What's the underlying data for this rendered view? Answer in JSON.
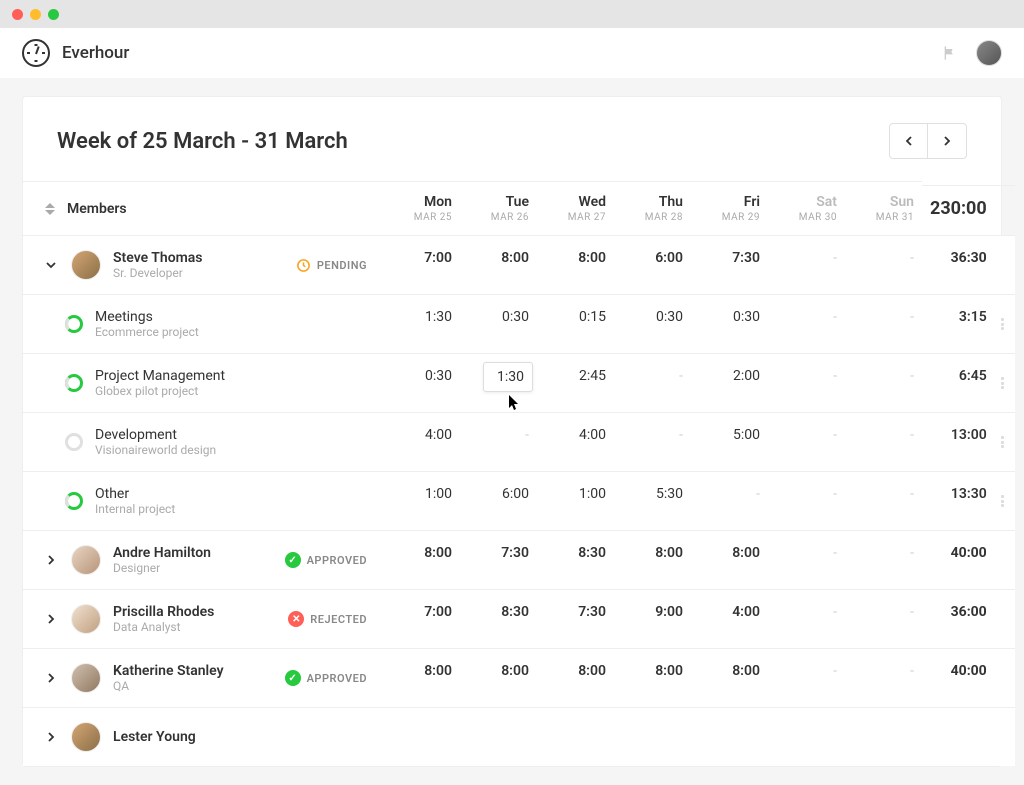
{
  "app": {
    "name": "Everhour"
  },
  "header": {
    "week_title": "Week of 25 March - 31 March"
  },
  "columns": {
    "members_label": "Members",
    "days": [
      {
        "name": "Mon",
        "date": "MAR 25",
        "weekend": false
      },
      {
        "name": "Tue",
        "date": "MAR 26",
        "weekend": false
      },
      {
        "name": "Wed",
        "date": "MAR 27",
        "weekend": false
      },
      {
        "name": "Thu",
        "date": "MAR 28",
        "weekend": false
      },
      {
        "name": "Fri",
        "date": "MAR 29",
        "weekend": false
      },
      {
        "name": "Sat",
        "date": "MAR 30",
        "weekend": true
      },
      {
        "name": "Sun",
        "date": "MAR 31",
        "weekend": true
      }
    ],
    "grand_total": "230:00"
  },
  "members": [
    {
      "name": "Steve Thomas",
      "role": "Sr. Developer",
      "status": "PENDING",
      "status_kind": "pending",
      "expanded": true,
      "days": [
        "7:00",
        "8:00",
        "8:00",
        "6:00",
        "7:30",
        "-",
        "-"
      ],
      "total": "36:30",
      "tasks": [
        {
          "name": "Meetings",
          "project": "Ecommerce project",
          "progress": "partial",
          "days": [
            "1:30",
            "0:30",
            "0:15",
            "0:30",
            "0:30",
            "-",
            "-"
          ],
          "total": "3:15"
        },
        {
          "name": "Project Management",
          "project": "Globex pilot project",
          "progress": "partial",
          "days": [
            "0:30",
            "1:30",
            "2:45",
            "-",
            "2:00",
            "-",
            "-"
          ],
          "total": "6:45",
          "editing_idx": 1
        },
        {
          "name": "Development",
          "project": "Visionaireworld design",
          "progress": "empty",
          "days": [
            "4:00",
            "-",
            "4:00",
            "-",
            "5:00",
            "-",
            "-"
          ],
          "total": "13:00"
        },
        {
          "name": "Other",
          "project": "Internal project",
          "progress": "partial",
          "days": [
            "1:00",
            "6:00",
            "1:00",
            "5:30",
            "-",
            "-",
            "-"
          ],
          "total": "13:30"
        }
      ]
    },
    {
      "name": "Andre Hamilton",
      "role": "Designer",
      "status": "APPROVED",
      "status_kind": "approved",
      "expanded": false,
      "days": [
        "8:00",
        "7:30",
        "8:30",
        "8:00",
        "8:00",
        "-",
        "-"
      ],
      "total": "40:00"
    },
    {
      "name": "Priscilla Rhodes",
      "role": "Data Analyst",
      "status": "REJECTED",
      "status_kind": "rejected",
      "expanded": false,
      "days": [
        "7:00",
        "8:30",
        "7:30",
        "9:00",
        "4:00",
        "-",
        "-"
      ],
      "total": "36:00"
    },
    {
      "name": "Katherine Stanley",
      "role": "QA",
      "status": "APPROVED",
      "status_kind": "approved",
      "expanded": false,
      "days": [
        "8:00",
        "8:00",
        "8:00",
        "8:00",
        "8:00",
        "-",
        "-"
      ],
      "total": "40:00"
    },
    {
      "name": "Lester Young",
      "role": "",
      "status": "",
      "status_kind": "",
      "expanded": false,
      "days": [
        "",
        "",
        "",
        "",
        "",
        "",
        ""
      ],
      "total": ""
    }
  ]
}
